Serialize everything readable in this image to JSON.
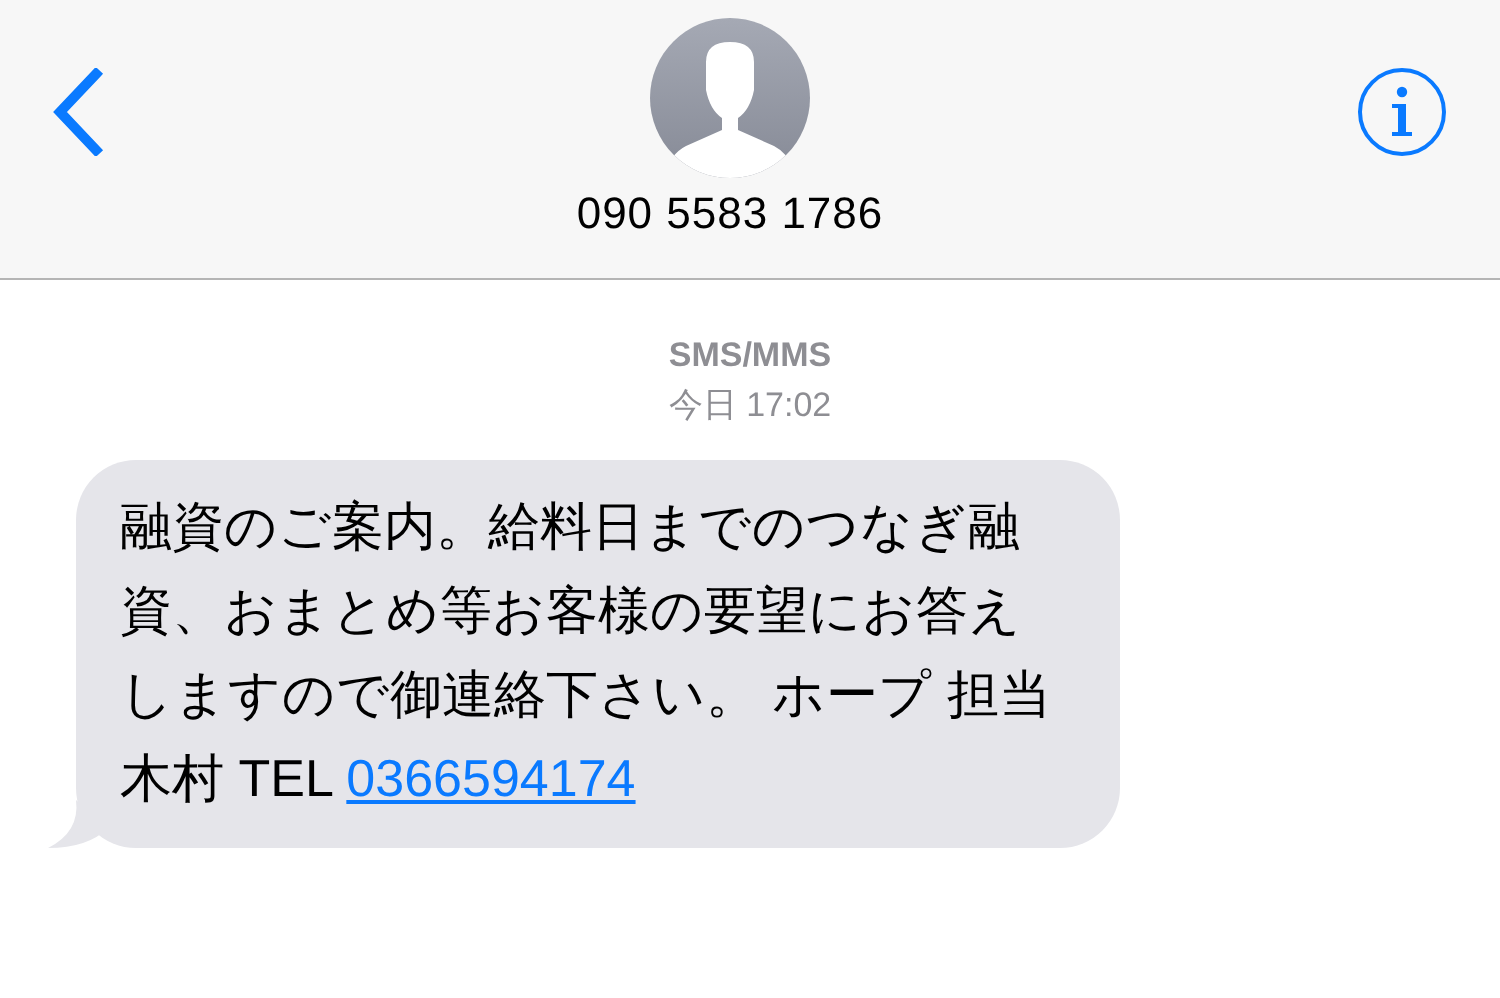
{
  "header": {
    "contact": "090 5583 1786"
  },
  "thread": {
    "service": "SMS/MMS",
    "timestamp": "今日 17:02"
  },
  "messages": [
    {
      "kind": "incoming",
      "text": "融資のご案内。給料日までのつなぎ融資、おまとめ等お客様の要望にお答えしますので御連絡下さい。 ホープ 担当木村 TEL ",
      "link": "0366594174"
    }
  ]
}
